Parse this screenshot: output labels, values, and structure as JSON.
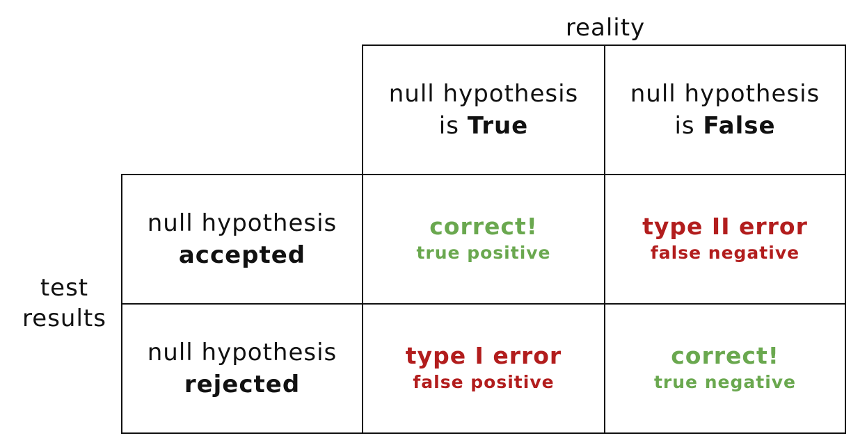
{
  "axes": {
    "columns_title": "reality",
    "rows_title_line1": "test",
    "rows_title_line2": "results"
  },
  "columns": [
    {
      "line1": "null hypothesis",
      "prefix": "is ",
      "emphasis": "True"
    },
    {
      "line1": "null hypothesis",
      "prefix": "is ",
      "emphasis": "False"
    }
  ],
  "rows": [
    {
      "line1": "null hypothesis",
      "emphasis": "accepted"
    },
    {
      "line1": "null hypothesis",
      "emphasis": "rejected"
    }
  ],
  "cells": [
    {
      "main": "correct!",
      "sub": "true positive"
    },
    {
      "main": "type II error",
      "sub": "false negative"
    },
    {
      "main": "type I error",
      "sub": "false positive"
    },
    {
      "main": "correct!",
      "sub": "true negative"
    }
  ],
  "colors": {
    "correct": "#6aa84f",
    "error": "#b21d1d",
    "border": "#111111"
  }
}
